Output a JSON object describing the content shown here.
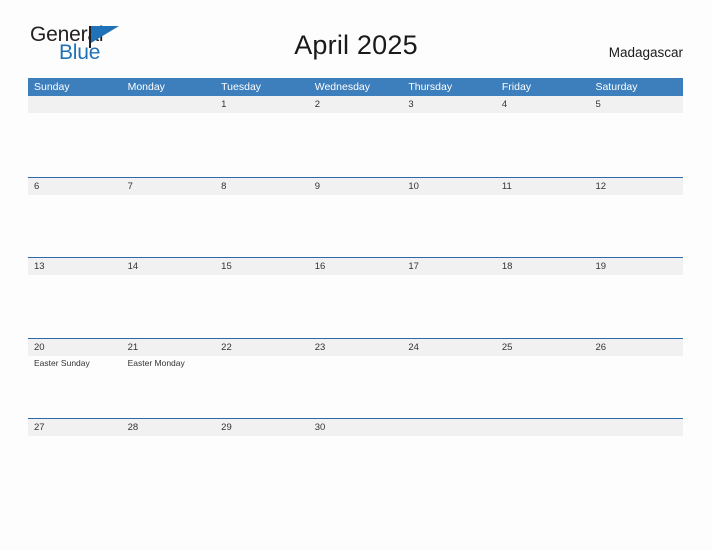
{
  "brand": {
    "name_primary": "General",
    "name_secondary": "Blue",
    "flag_icon": "blue-flag-triangle-icon",
    "primary_color": "#231f20",
    "secondary_color": "#1f72b8"
  },
  "header": {
    "title": "April 2025",
    "region": "Madagascar"
  },
  "theme": {
    "header_blue": "#3d7ebd",
    "row_divider_blue": "#2a6aab",
    "band_gray": "#f1f1f1",
    "page_background": "#fdfdfd",
    "text_color": "#333333"
  },
  "calendar": {
    "month": "April",
    "year": "2025",
    "weekday_headers": [
      "Sunday",
      "Monday",
      "Tuesday",
      "Wednesday",
      "Thursday",
      "Friday",
      "Saturday"
    ],
    "weeks": [
      {
        "days": [
          {
            "number": "",
            "events": []
          },
          {
            "number": "",
            "events": []
          },
          {
            "number": "1",
            "events": []
          },
          {
            "number": "2",
            "events": []
          },
          {
            "number": "3",
            "events": []
          },
          {
            "number": "4",
            "events": []
          },
          {
            "number": "5",
            "events": []
          }
        ]
      },
      {
        "days": [
          {
            "number": "6",
            "events": []
          },
          {
            "number": "7",
            "events": []
          },
          {
            "number": "8",
            "events": []
          },
          {
            "number": "9",
            "events": []
          },
          {
            "number": "10",
            "events": []
          },
          {
            "number": "11",
            "events": []
          },
          {
            "number": "12",
            "events": []
          }
        ]
      },
      {
        "days": [
          {
            "number": "13",
            "events": []
          },
          {
            "number": "14",
            "events": []
          },
          {
            "number": "15",
            "events": []
          },
          {
            "number": "16",
            "events": []
          },
          {
            "number": "17",
            "events": []
          },
          {
            "number": "18",
            "events": []
          },
          {
            "number": "19",
            "events": []
          }
        ]
      },
      {
        "days": [
          {
            "number": "20",
            "events": [
              "Easter Sunday"
            ]
          },
          {
            "number": "21",
            "events": [
              "Easter Monday"
            ]
          },
          {
            "number": "22",
            "events": []
          },
          {
            "number": "23",
            "events": []
          },
          {
            "number": "24",
            "events": []
          },
          {
            "number": "25",
            "events": []
          },
          {
            "number": "26",
            "events": []
          }
        ]
      },
      {
        "days": [
          {
            "number": "27",
            "events": []
          },
          {
            "number": "28",
            "events": []
          },
          {
            "number": "29",
            "events": []
          },
          {
            "number": "30",
            "events": []
          },
          {
            "number": "",
            "events": []
          },
          {
            "number": "",
            "events": []
          },
          {
            "number": "",
            "events": []
          }
        ]
      }
    ]
  }
}
